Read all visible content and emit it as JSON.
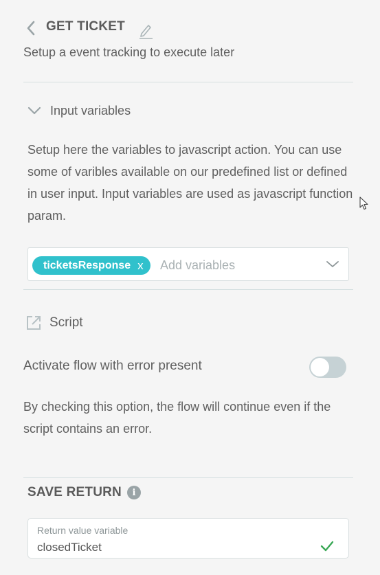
{
  "header": {
    "title": "GET TICKET",
    "subtitle": "Setup a event tracking to execute later"
  },
  "input_variables": {
    "label": "Input variables",
    "description": "Setup here the variables to javascript action. You can use some of varibles available on our predefined list or defined in user input. Input variables are used as javascript function param.",
    "chips": [
      {
        "label": "ticketsResponse",
        "remove": "x"
      }
    ],
    "placeholder": "Add variables"
  },
  "script": {
    "label": "Script"
  },
  "error_flow": {
    "label": "Activate flow with error present",
    "enabled": false,
    "note": "By checking this option, the flow will continue even if the script contains an error."
  },
  "save_return": {
    "title": "SAVE RETURN",
    "info_glyph": "i",
    "field_label": "Return value variable",
    "field_value": "closedTicket",
    "valid": true
  },
  "colors": {
    "accent": "#30c1cc",
    "success": "#3aa856",
    "toggle_off": "#c6d2d5"
  }
}
